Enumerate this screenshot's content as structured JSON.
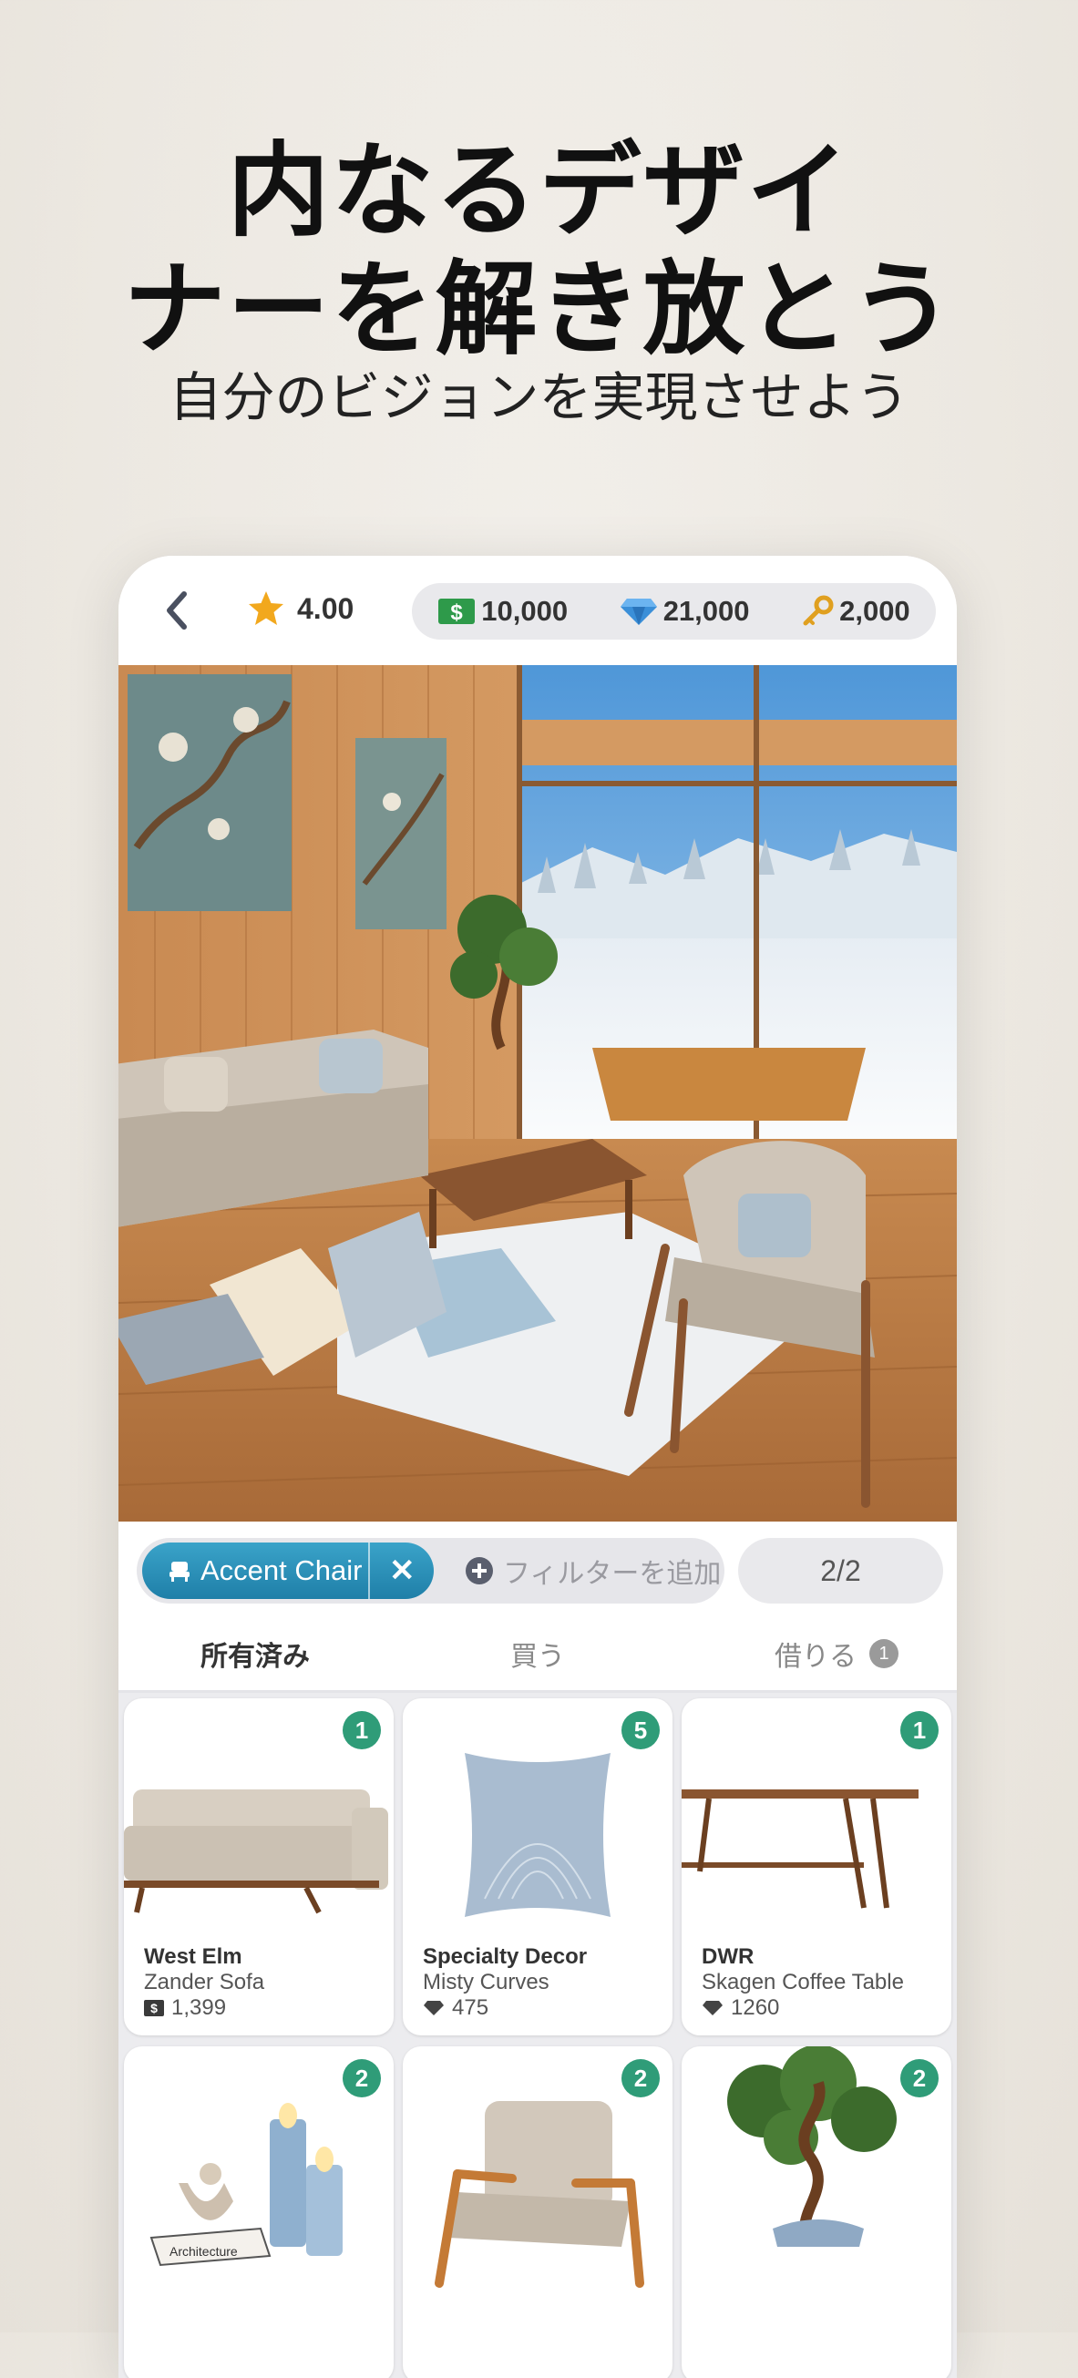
{
  "promo": {
    "headline_line1": "内なるデザイ",
    "headline_line2": "ナーを解き放とう",
    "subtitle": "自分のビジョンを実現させよう"
  },
  "topbar": {
    "rating": "4.00",
    "cash": "10,000",
    "diamonds": "21,000",
    "keys": "2,000"
  },
  "filter": {
    "active_chip": "Accent Chair",
    "add_filter": "フィルターを追加",
    "page": "2/2"
  },
  "tabs": {
    "owned": "所有済み",
    "buy": "買う",
    "rent": "借りる",
    "rent_badge": "1"
  },
  "items": [
    {
      "count": "1",
      "brand": "West Elm",
      "name": "Zander Sofa",
      "price": "1,399",
      "currency": "cash-icon"
    },
    {
      "count": "5",
      "brand": "Specialty Decor",
      "name": "Misty Curves",
      "price": "475",
      "currency": "diamond-icon"
    },
    {
      "count": "1",
      "brand": "DWR",
      "name": "Skagen Coffee Table",
      "price": "1260",
      "currency": "diamond-icon"
    },
    {
      "count": "2",
      "brand": "",
      "name": "",
      "price": "",
      "currency": ""
    },
    {
      "count": "2",
      "brand": "",
      "name": "",
      "price": "",
      "currency": ""
    },
    {
      "count": "2",
      "brand": "",
      "name": "",
      "price": "",
      "currency": ""
    }
  ],
  "decor_text": {
    "book_label": "Architecture"
  },
  "colors": {
    "accent_blue": "#2a8fb8",
    "badge_green": "#2f9c78",
    "cash_green": "#2e9a4a",
    "diamond_blue": "#3b8fd8",
    "key_gold": "#e0a020",
    "star_gold": "#f2a81d"
  }
}
